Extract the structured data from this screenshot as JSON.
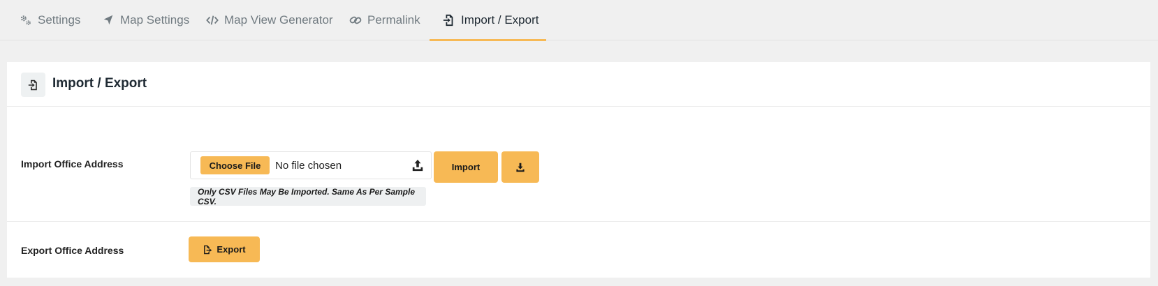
{
  "tabs": [
    {
      "label": "Settings",
      "icon": "gears-icon",
      "active": false
    },
    {
      "label": "Map Settings",
      "icon": "location-arrow-icon",
      "active": false
    },
    {
      "label": "Map View Generator",
      "icon": "code-icon",
      "active": false
    },
    {
      "label": "Permalink",
      "icon": "link-icon",
      "active": false
    },
    {
      "label": "Import / Export",
      "icon": "file-import-icon",
      "active": true
    }
  ],
  "card": {
    "title": "Import / Export",
    "title_icon": "file-import-icon"
  },
  "import": {
    "label": "Import Office Address",
    "choose_file_label": "Choose File",
    "file_status": "No file chosen",
    "import_button": "Import",
    "download_icon": "download-icon",
    "note": "Only CSV Files May Be Imported. Same As Per Sample CSV."
  },
  "export": {
    "label": "Export Office Address",
    "export_button": "Export"
  },
  "colors": {
    "accent": "#f7b955",
    "background": "#f0f0f0",
    "card": "#ffffff"
  }
}
